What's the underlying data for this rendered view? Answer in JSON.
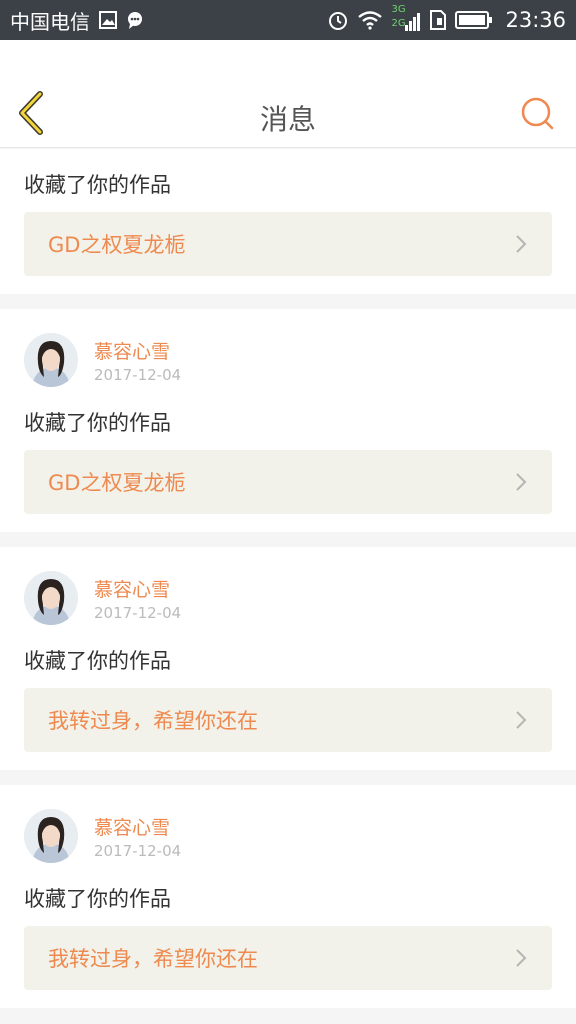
{
  "status_bar": {
    "carrier": "中国电信",
    "network_3g": "3G",
    "network_2g": "2G",
    "time": "23:36",
    "icons": [
      "image-icon",
      "chat-icon",
      "alarm-icon",
      "wifi-icon",
      "signal-icon",
      "sim-icon",
      "battery-icon"
    ]
  },
  "header": {
    "title": "消息",
    "back_icon": "chevron-left-icon",
    "search_icon": "search-icon",
    "accent": "#ee8a4f"
  },
  "messages": [
    {
      "user": "",
      "date": "",
      "action": "收藏了你的作品",
      "work": "GD之权夏龙栀"
    },
    {
      "user": "慕容心雪",
      "date": "2017-12-04",
      "action": "收藏了你的作品",
      "work": "GD之权夏龙栀"
    },
    {
      "user": "慕容心雪",
      "date": "2017-12-04",
      "action": "收藏了你的作品",
      "work": "我转过身，希望你还在"
    },
    {
      "user": "慕容心雪",
      "date": "2017-12-04",
      "action": "收藏了你的作品",
      "work": "我转过身，希望你还在"
    }
  ]
}
